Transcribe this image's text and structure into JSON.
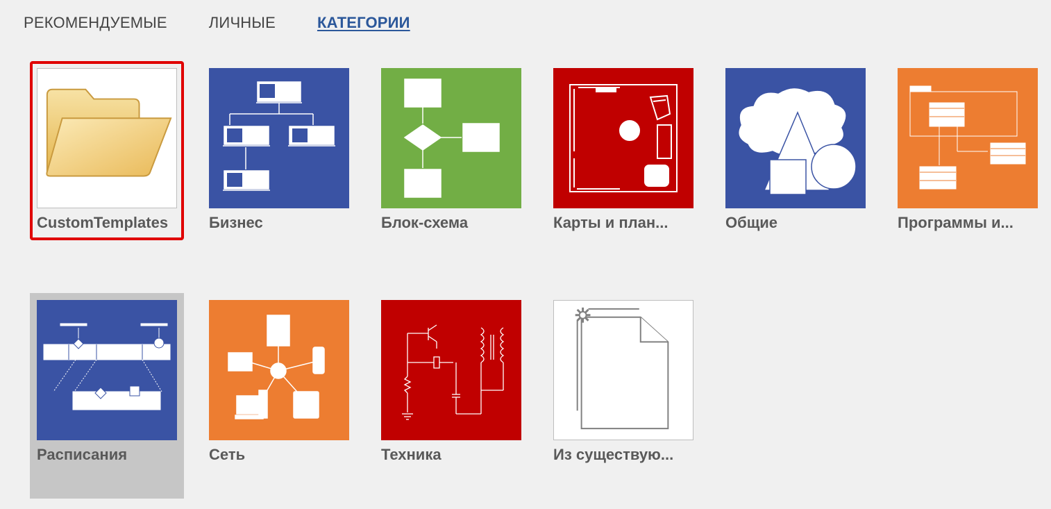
{
  "tabs": [
    {
      "label": "РЕКОМЕНДУЕМЫЕ",
      "active": false
    },
    {
      "label": "ЛИЧНЫЕ",
      "active": false
    },
    {
      "label": "КАТЕГОРИИ",
      "active": true
    }
  ],
  "tiles": [
    {
      "label": "CustomTemplates",
      "icon": "folder-icon"
    },
    {
      "label": "Бизнес",
      "icon": "business-org-chart-icon",
      "color": "#3a53a4"
    },
    {
      "label": "Блок-схема",
      "icon": "flowchart-icon",
      "color": "#72ae45"
    },
    {
      "label": "Карты и план...",
      "icon": "floor-plan-icon",
      "color": "#c00000"
    },
    {
      "label": "Общие",
      "icon": "basic-shapes-icon",
      "color": "#3a53a4"
    },
    {
      "label": "Программы и...",
      "icon": "software-uml-icon",
      "color": "#ed7d31"
    },
    {
      "label": "Расписания",
      "icon": "timeline-icon",
      "color": "#3a53a4"
    },
    {
      "label": "Сеть",
      "icon": "network-icon",
      "color": "#ed7d31"
    },
    {
      "label": "Техника",
      "icon": "circuit-icon",
      "color": "#c00000"
    },
    {
      "label": "Из существую...",
      "icon": "new-from-existing-icon"
    }
  ]
}
